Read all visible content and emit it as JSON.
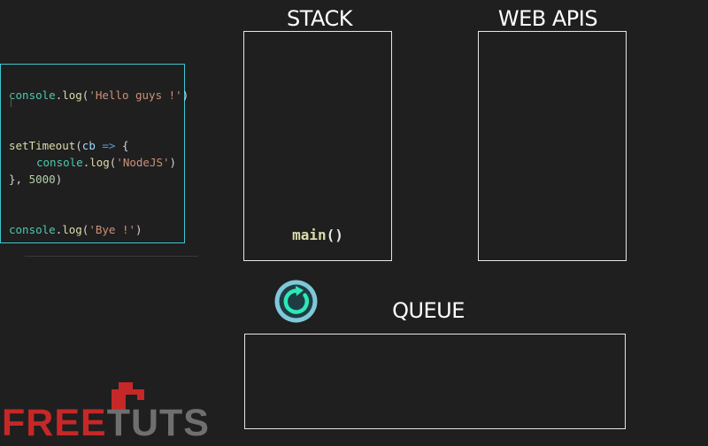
{
  "code": {
    "line1": {
      "obj": "console",
      "dot": ".",
      "fn": "log",
      "open": "(",
      "str": "'Hello guys !'",
      "close": ")"
    },
    "line2": {
      "fn": "setTimeout",
      "open": "(",
      "param": "cb",
      "arrow": " =>",
      "brace": " {"
    },
    "line3": {
      "obj": "console",
      "dot": ".",
      "fn": "log",
      "open": "(",
      "str": "'NodeJS'",
      "close": ")"
    },
    "line4": {
      "close": "}, ",
      "num": "5000",
      "paren": ")"
    },
    "line5": {
      "obj": "console",
      "dot": ".",
      "fn": "log",
      "open": "(",
      "str": "'Bye !'",
      "close": ")"
    }
  },
  "panels": {
    "stack": {
      "title": "STACK",
      "items": [
        {
          "name": "main",
          "parens": "()"
        }
      ]
    },
    "web_apis": {
      "title": "WEB APIS"
    },
    "queue": {
      "title": "QUEUE"
    }
  },
  "icons": {
    "event_loop": "refresh-icon"
  },
  "logo": {
    "text": "FREETUTS",
    "colors": {
      "free": "#c62828",
      "tuts": "#6f6f6f"
    }
  },
  "colors": {
    "background": "#1f1f1f",
    "code_border": "#3ec6cf",
    "panel_border": "#e6e6e6",
    "loop_outer": "#7fc8d8",
    "loop_inner": "#2ee8b8"
  }
}
